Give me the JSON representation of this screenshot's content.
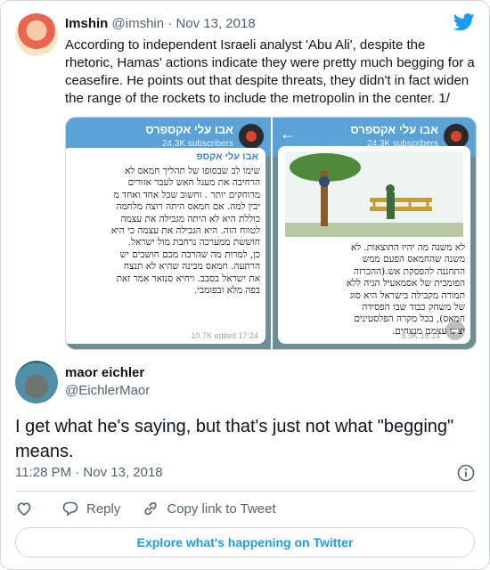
{
  "quoted": {
    "name": "Imshin",
    "handle": "@imshin",
    "separator": "·",
    "date": "Nov 13, 2018",
    "text": "According to independent Israeli analyst 'Abu Ali', despite the rhetoric, Hamas' actions indicate they were pretty much begging for a ceasefire. He points out that despite threats, they didn't in fact widen the range of the rockets to include the metropolin in the center. 1/"
  },
  "media": {
    "left": {
      "channel": "אבו עלי אקספרס",
      "subscribers": "24.3K subscribers",
      "author": "אבו עלי אקספ",
      "text": "שימו לב שבסופו של תהליך חמאס לא\nהרחיבה את מעגל האש לעבר אזורים\nמרוחקים יותר . וחשוב שכל אחד ואחד מ\nיבין למה. אם חמאס היתה רוצה מלחמה\nכוללת היא לא היתה מגבילה את עצמה\nלטווח הזה. היא הגבילה את עצמה כי היא\nחוששת ממערכה נרחבת מול ישראל.\nכן, למרות מה שהרבה מכם חושבים יש\nהרתעה. חמאס מבינה שהיא לא תנצח\nאת ישראל בסבב. ויחיא סנואר אמר זאת\nבפה מלא ובפומבי.",
      "meta": "10.7K edited 17:24"
    },
    "right": {
      "back_icon": "arrow-back-icon",
      "channel": "אבו עלי אקספרס",
      "subscribers": "24.3K subscribers",
      "text": "לא משנה מה יהיו התוצאות. לא\nמשנה שהחמאס הפעם ממש\nהתחננה להפסקת אש.(ההכרזה\nהפומבית של אסמאעיל הניה ללא\nתמורה מקבילה בישראל היא סוג\nשל משחק כבוד שבו הפסידה\nחמאס), בכל מקרה הפלסטינים\nיציגו עצמם מנצחים.",
      "meta": "8.9K 18:14"
    }
  },
  "reply": {
    "name": "maor eichler",
    "handle": "@EichlerMaor",
    "text": "I get what he's saying, but that's just not what \"begging\" means.",
    "time": "11:28 PM · Nov 13, 2018"
  },
  "actions": {
    "reply_label": "Reply",
    "copy_label": "Copy link to Tweet"
  },
  "explore_label": "Explore what's happening on Twitter",
  "colors": {
    "accent": "#1d9bf0",
    "telegram_bar": "#5ba3d6",
    "muted": "#536471"
  }
}
